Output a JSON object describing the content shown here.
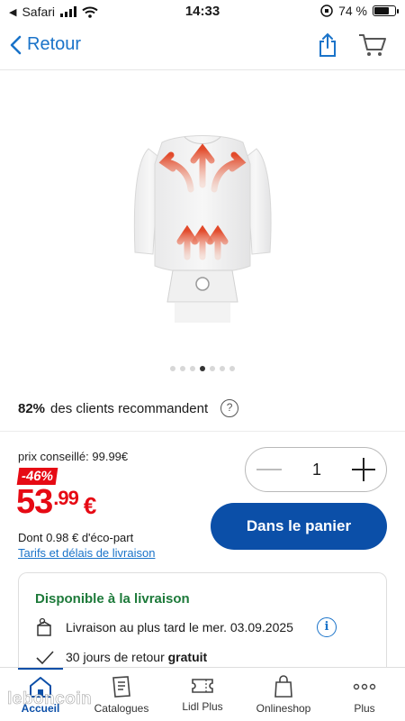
{
  "status_bar": {
    "back_app": "Safari",
    "time": "14:33",
    "battery": "74 %",
    "battery_level": 0.74
  },
  "nav": {
    "back_label": "Retour"
  },
  "product": {
    "image_icon": "shirt-dryer-image",
    "carousel_count": 7,
    "carousel_active": 4,
    "recommend_pct": "82%",
    "recommend_text": "des clients recommandent",
    "help_symbol": "?",
    "rrp": "prix conseillé: 99.99€",
    "discount": "-46%",
    "price_main": "53",
    "price_cents": ".99",
    "price_currency": "€",
    "eco_fee": "Dont 0.98 € d'éco-part",
    "delivery_link": "Tarifs et délais de livraison"
  },
  "quantity": {
    "value": "1"
  },
  "cart_button": "Dans le panier",
  "availability": {
    "title": "Disponible à la livraison",
    "delivery_text": "Livraison au plus tard le mer. 03.09.2025",
    "info_symbol": "i",
    "return_text": "30 jours de retour",
    "return_bold": "gratuit"
  },
  "tabbar": {
    "items": [
      {
        "label": "Accueil",
        "icon": "home-icon"
      },
      {
        "label": "Catalogues",
        "icon": "catalog-icon"
      },
      {
        "label": "Lidl Plus",
        "icon": "ticket-icon"
      },
      {
        "label": "Onlineshop",
        "icon": "shopping-bag-icon"
      },
      {
        "label": "Plus",
        "icon": "more-icon"
      }
    ]
  },
  "watermark": "leboncoin",
  "colors": {
    "accent_blue": "#0b4fa8",
    "link_blue": "#1a73c9",
    "price_red": "#e60a14",
    "available_green": "#1d7a3a"
  }
}
